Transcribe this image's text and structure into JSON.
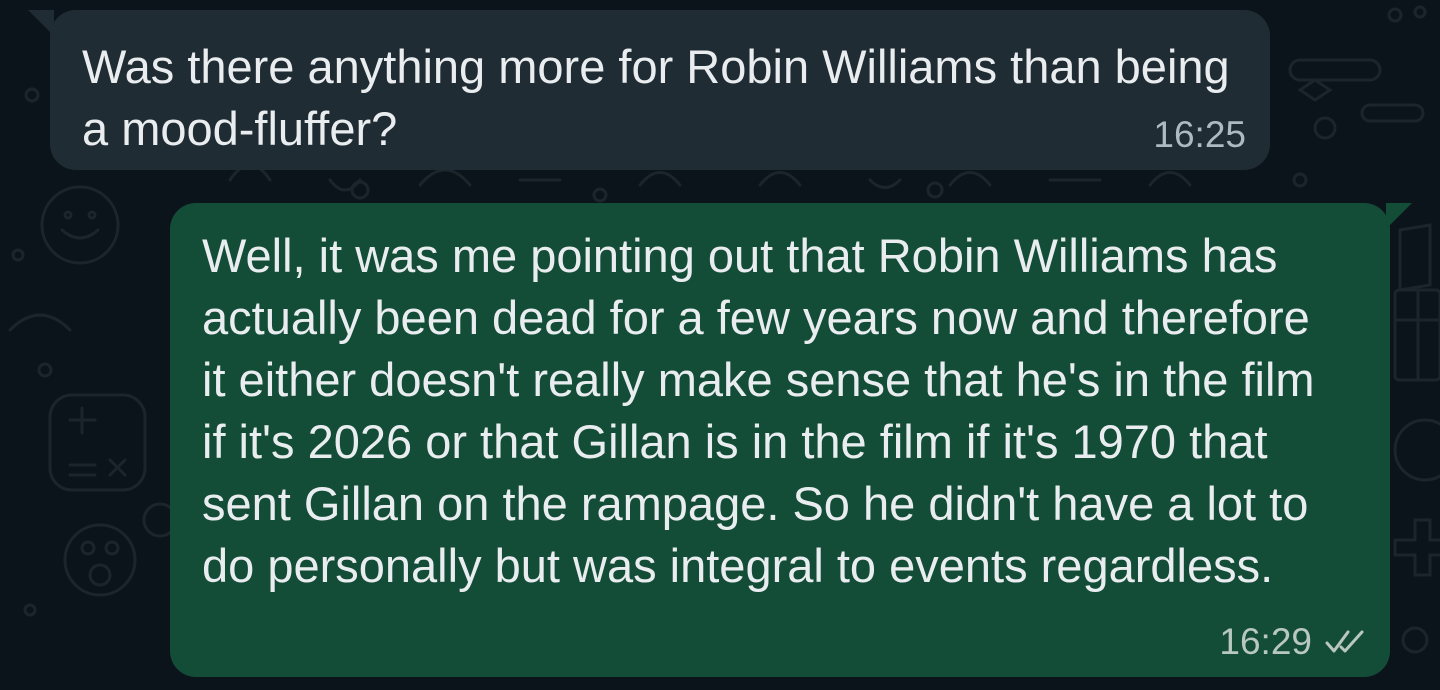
{
  "colors": {
    "wallpaper_bg": "#0b141a",
    "incoming_bubble": "#202c33",
    "outgoing_bubble": "#144d37",
    "message_text": "#e9edef",
    "timestamp": "#aebac1",
    "read_receipt": "#b8c7c2"
  },
  "messages": [
    {
      "direction": "incoming",
      "text": "Was there anything more for Robin Williams than being a mood-fluffer?",
      "time": "16:25"
    },
    {
      "direction": "outgoing",
      "text": "Well, it was me pointing out that Robin Williams has actually been dead for a few years now and therefore it either doesn't really make sense that he's in the film if it's 2026 or that Gillan is in the film if it's 1970 that sent Gillan on the rampage. So he didn't have a lot to do personally but was integral to events regardless.",
      "time": "16:29",
      "status_icon": "double-check-icon"
    }
  ]
}
